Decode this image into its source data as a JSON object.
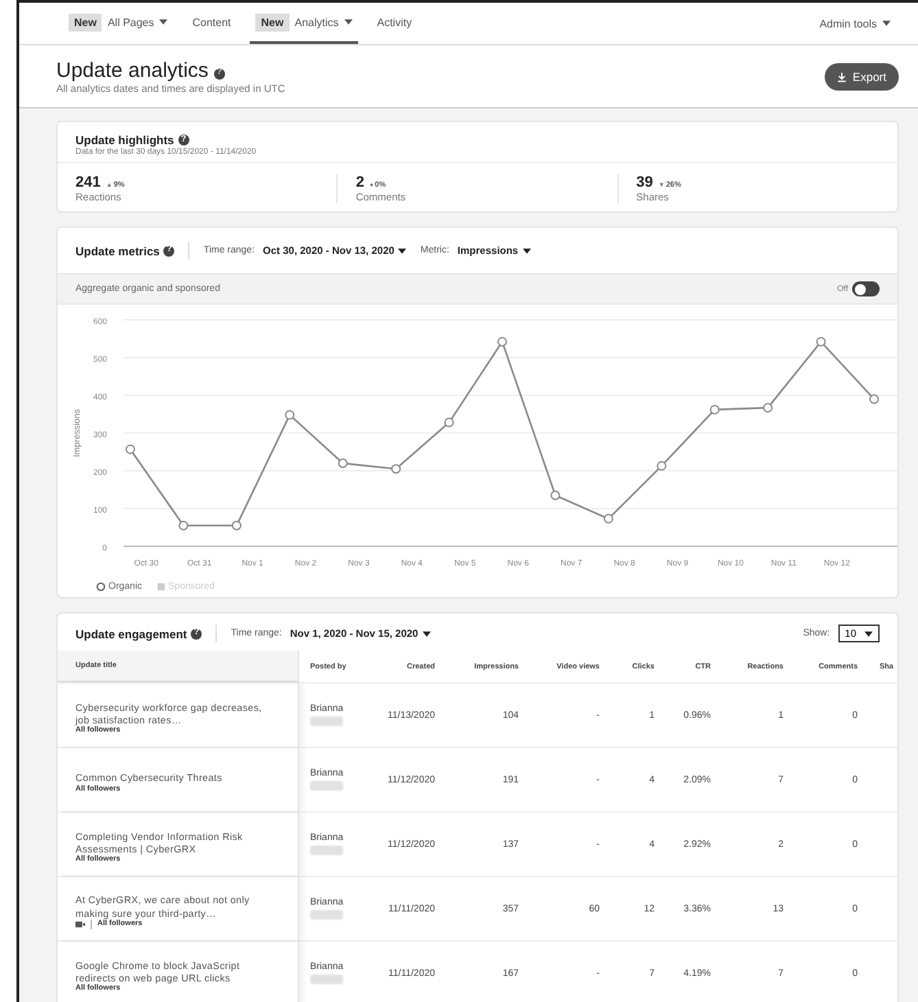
{
  "nav": {
    "items": [
      {
        "badge": "New",
        "label": "All Pages",
        "dropdown": true,
        "selected": false
      },
      {
        "label": "Content",
        "dropdown": false,
        "selected": false
      },
      {
        "badge": "New",
        "label": "Analytics",
        "dropdown": true,
        "selected": true
      },
      {
        "label": "Activity",
        "dropdown": false,
        "selected": false
      }
    ],
    "admin": "Admin tools"
  },
  "header": {
    "title": "Update analytics",
    "help": "?",
    "subtitle": "All analytics dates and times are displayed in UTC",
    "export": "Export"
  },
  "highlights": {
    "title": "Update highlights",
    "help": "?",
    "subtitle": "Data for the last 30 days 10/15/2020 - 11/14/2020",
    "stats": [
      {
        "value": "241",
        "trend_icon": "▲",
        "change": "9%",
        "label": "Reactions"
      },
      {
        "value": "2",
        "trend_icon": "●",
        "change": "0%",
        "label": "Comments"
      },
      {
        "value": "39",
        "trend_icon": "▼",
        "change": "26%",
        "label": "Shares"
      }
    ]
  },
  "metrics": {
    "title": "Update metrics",
    "help": "?",
    "range_label": "Time range:",
    "range": "Oct 30, 2020 - Nov 13, 2020",
    "metric_label": "Metric:",
    "metric": "Impressions",
    "aggregate": "Aggregate organic and sponsored",
    "toggle_label": "Off",
    "toggle_on": false,
    "legend": [
      {
        "name": "Organic",
        "active": true
      },
      {
        "name": "Sponsored",
        "active": false
      }
    ],
    "chart_data": {
      "type": "line",
      "grid": true,
      "ylabel": "Impressions",
      "categories": [
        "Oct 30",
        "Oct 31",
        "Nov 1",
        "Nov 2",
        "Nov 3",
        "Nov 4",
        "Nov 5",
        "Nov 6",
        "Nov 7",
        "Nov 8",
        "Nov 9",
        "Nov 10",
        "Nov 11",
        "Nov 12",
        null
      ],
      "ylim": [
        0,
        600
      ],
      "yticks": [
        0,
        100,
        200,
        300,
        400,
        500,
        600
      ],
      "series": [
        {
          "color": "#8a8a8a",
          "marker": "circle",
          "values": [
            257,
            55,
            55,
            348,
            220,
            205,
            328,
            542,
            135,
            73,
            213,
            362,
            367,
            542,
            390
          ]
        }
      ]
    }
  },
  "engagement": {
    "title": "Update engagement",
    "help": "?",
    "range_label": "Time range:",
    "range": "Nov 1, 2020 - Nov 15, 2020",
    "show_label": "Show:",
    "show_value": "10",
    "columns": [
      "Update title",
      "Posted by",
      "Created",
      "Impressions",
      "Video views",
      "Clicks",
      "CTR",
      "Reactions",
      "Comments",
      "Sha"
    ],
    "rows": [
      {
        "title": "Cybersecurity workforce gap decreases, job satisfaction rates…",
        "audience": "All followers",
        "has_video": false,
        "posted_by": "Brianna",
        "created": "11/13/2020",
        "impressions": "104",
        "video_views": "-",
        "clicks": "1",
        "ctr": "0.96%",
        "reactions": "1",
        "comments": "0"
      },
      {
        "title": "Common Cybersecurity Threats",
        "audience": "All followers",
        "has_video": false,
        "posted_by": "Brianna",
        "created": "11/12/2020",
        "impressions": "191",
        "video_views": "-",
        "clicks": "4",
        "ctr": "2.09%",
        "reactions": "7",
        "comments": "0"
      },
      {
        "title": "Completing Vendor Information Risk Assessments | CyberGRX",
        "audience": "All followers",
        "has_video": false,
        "posted_by": "Brianna",
        "created": "11/12/2020",
        "impressions": "137",
        "video_views": "-",
        "clicks": "4",
        "ctr": "2.92%",
        "reactions": "2",
        "comments": "0"
      },
      {
        "title": "At CyberGRX, we care about not only making sure your third-party…",
        "audience": "All followers",
        "has_video": true,
        "posted_by": "Brianna",
        "created": "11/11/2020",
        "impressions": "357",
        "video_views": "60",
        "clicks": "12",
        "ctr": "3.36%",
        "reactions": "13",
        "comments": "0"
      },
      {
        "title": "Google Chrome to block JavaScript redirects on web page URL clicks",
        "audience": "All followers",
        "has_video": false,
        "posted_by": "Brianna",
        "created": "11/11/2020",
        "impressions": "167",
        "video_views": "-",
        "clicks": "7",
        "ctr": "4.19%",
        "reactions": "7",
        "comments": "0"
      }
    ]
  }
}
